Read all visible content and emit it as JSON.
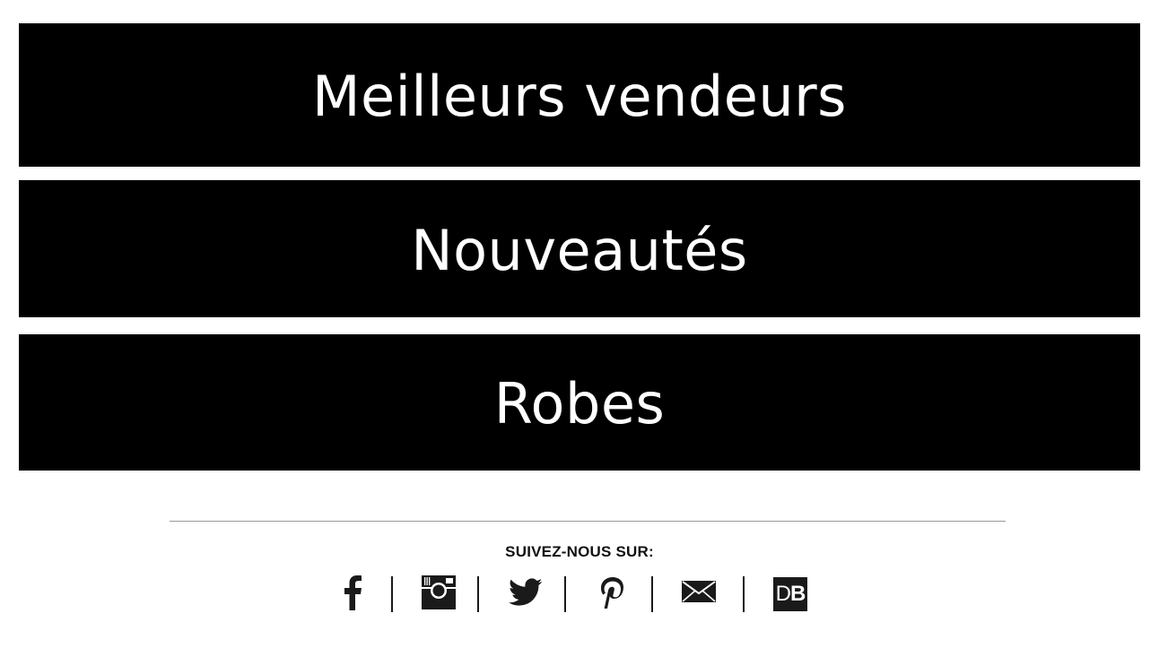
{
  "banners": [
    {
      "label": "Meilleurs vendeurs"
    },
    {
      "label": "Nouveautés"
    },
    {
      "label": "Robes"
    }
  ],
  "footer": {
    "follow_label": "SUIVEZ-NOUS SUR:",
    "social": [
      {
        "icon": "facebook-icon"
      },
      {
        "icon": "instagram-icon"
      },
      {
        "icon": "twitter-icon"
      },
      {
        "icon": "pinterest-icon"
      },
      {
        "icon": "email-icon"
      },
      {
        "icon": "db-icon",
        "text_d": "D",
        "text_b": "B"
      }
    ]
  },
  "colors": {
    "banner_bg": "#000000",
    "banner_text": "#ffffff",
    "icon": "#1a1a1a",
    "divider": "#9a9a9a"
  }
}
